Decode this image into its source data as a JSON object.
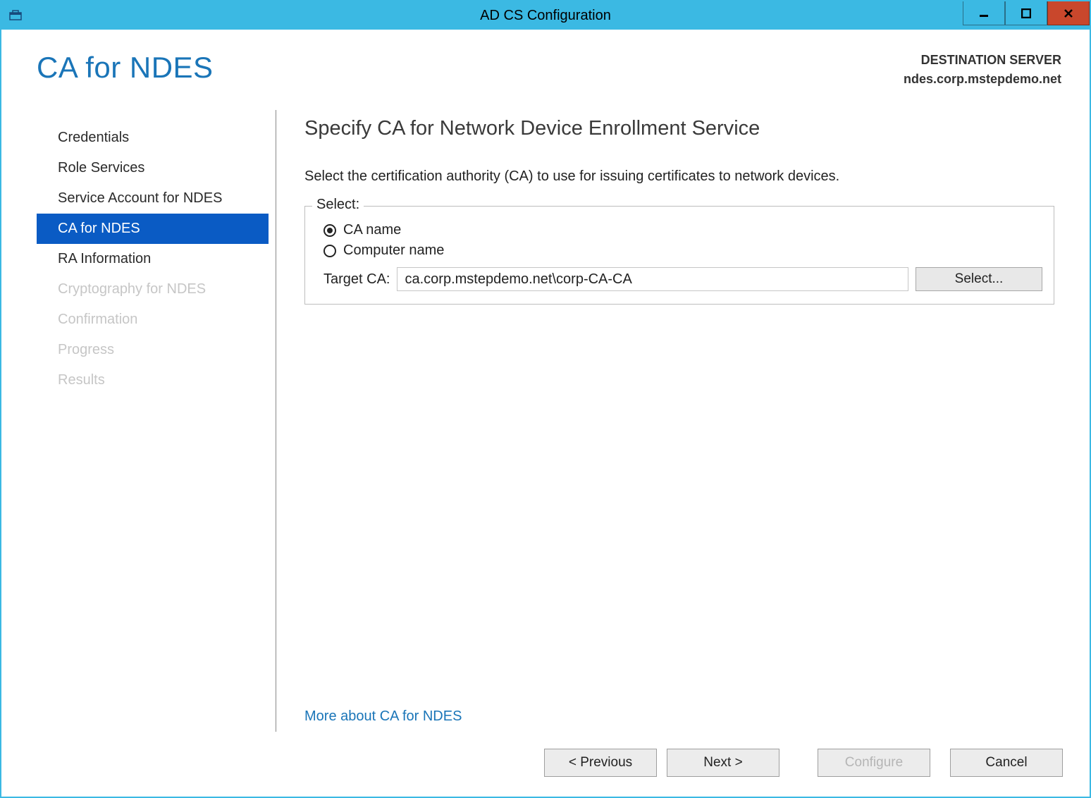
{
  "window": {
    "title": "AD CS Configuration"
  },
  "header": {
    "page_heading": "CA for NDES",
    "destination_label": "DESTINATION SERVER",
    "destination_value": "ndes.corp.mstepdemo.net"
  },
  "sidebar": {
    "items": [
      {
        "label": "Credentials",
        "state": "done"
      },
      {
        "label": "Role Services",
        "state": "done"
      },
      {
        "label": "Service Account for NDES",
        "state": "done"
      },
      {
        "label": "CA for NDES",
        "state": "active"
      },
      {
        "label": "RA Information",
        "state": "next"
      },
      {
        "label": "Cryptography for NDES",
        "state": "disabled"
      },
      {
        "label": "Confirmation",
        "state": "disabled"
      },
      {
        "label": "Progress",
        "state": "disabled"
      },
      {
        "label": "Results",
        "state": "disabled"
      }
    ]
  },
  "main": {
    "heading": "Specify CA for Network Device Enrollment Service",
    "instruction": "Select the certification authority (CA) to use for issuing certificates to network devices.",
    "fieldset_legend": "Select:",
    "radio_ca_name": "CA name",
    "radio_computer_name": "Computer name",
    "target_label": "Target CA:",
    "target_value": "ca.corp.mstepdemo.net\\corp-CA-CA",
    "select_button": "Select...",
    "more_link": "More about CA for NDES",
    "radio_selected": "ca_name"
  },
  "footer": {
    "previous": "< Previous",
    "next": "Next >",
    "configure": "Configure",
    "cancel": "Cancel"
  }
}
